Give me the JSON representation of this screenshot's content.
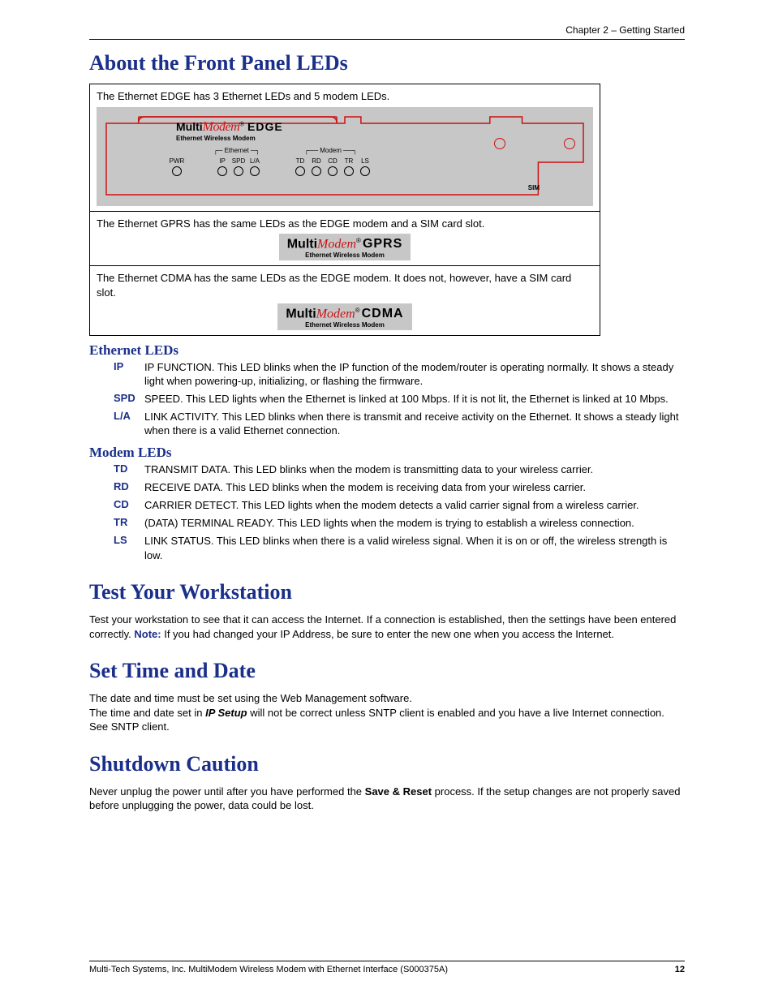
{
  "header": {
    "chapter": "Chapter 2 – Getting Started"
  },
  "titles": {
    "about_leds": "About the Front Panel LEDs",
    "ethernet_leds": "Ethernet LEDs",
    "modem_leds": "Modem LEDs",
    "test_ws": "Test Your Workstation",
    "set_time": "Set Time and Date",
    "shutdown": "Shutdown Caution"
  },
  "panel": {
    "row1_text": "The Ethernet EDGE has 3 Ethernet LEDs and 5 modem LEDs.",
    "row2_text": "The Ethernet GPRS has the same LEDs as the EDGE modem and a SIM card slot.",
    "row3_text": "The Ethernet CDMA has the same LEDs as the EDGE modem. It does not, however, have a SIM card slot.",
    "brand_multi": "Multi",
    "brand_modem": "Modem",
    "brand_reg": "®",
    "variant_edge": "EDGE",
    "variant_gprs": "GPRS",
    "variant_cdma": "CDMA",
    "brand_sub": "Ethernet Wireless Modem",
    "pwr": "PWR",
    "eth_group": "Ethernet",
    "modem_group": "Modem",
    "sim": "SIM",
    "eth_leds": [
      "IP",
      "SPD",
      "L/A"
    ],
    "modem_leds": [
      "TD",
      "RD",
      "CD",
      "TR",
      "LS"
    ]
  },
  "ethernet_defs": [
    {
      "code": "IP",
      "desc": "IP FUNCTION. This LED blinks when the IP function of the modem/router is operating normally. It shows a steady light when powering-up, initializing, or flashing the firmware."
    },
    {
      "code": "SPD",
      "desc": "SPEED. This LED lights when the Ethernet is linked at 100 Mbps. If it is not lit, the Ethernet is linked at 10 Mbps."
    },
    {
      "code": "L/A",
      "desc": "LINK ACTIVITY. This LED blinks when there is transmit and receive activity on the Ethernet. It shows a steady light when there is a valid Ethernet connection."
    }
  ],
  "modem_defs": [
    {
      "code": "TD",
      "desc": "TRANSMIT DATA. This LED blinks when the modem is transmitting data to your wireless carrier."
    },
    {
      "code": "RD",
      "desc": "RECEIVE DATA. This LED blinks when the modem is receiving data from your wireless carrier."
    },
    {
      "code": "CD",
      "desc": "CARRIER DETECT. This LED lights when the modem detects a valid carrier signal from a wireless carrier."
    },
    {
      "code": "TR",
      "desc": "(DATA) TERMINAL READY. This LED lights when the modem is trying to establish a wireless connection."
    },
    {
      "code": "LS",
      "desc": "LINK STATUS. This LED blinks when there is a valid wireless signal. When it is on or off, the wireless strength is low."
    }
  ],
  "test_ws": {
    "p1a": "Test your workstation to see that it can access the Internet. If a connection is established, then the settings have been entered correctly. ",
    "note": "Note:",
    "p1b": " If you had changed your IP Address, be sure to enter the new one when you access the Internet."
  },
  "set_time": {
    "p1": "The date and time must be set using the Web Management software.",
    "p2a": "The time and date set in ",
    "ip_setup": "IP Setup",
    "p2b": " will not be correct unless SNTP client is enabled and you have a live Internet connection. See SNTP client."
  },
  "shutdown": {
    "p1a": "Never unplug the power until after you have performed the ",
    "save_reset": "Save & Reset",
    "p1b": " process. If the setup changes are not properly saved before unplugging the power, data could be lost."
  },
  "footer": {
    "left": "Multi-Tech Systems, Inc. MultiModem Wireless Modem with Ethernet Interface (S000375A)",
    "page": "12"
  }
}
